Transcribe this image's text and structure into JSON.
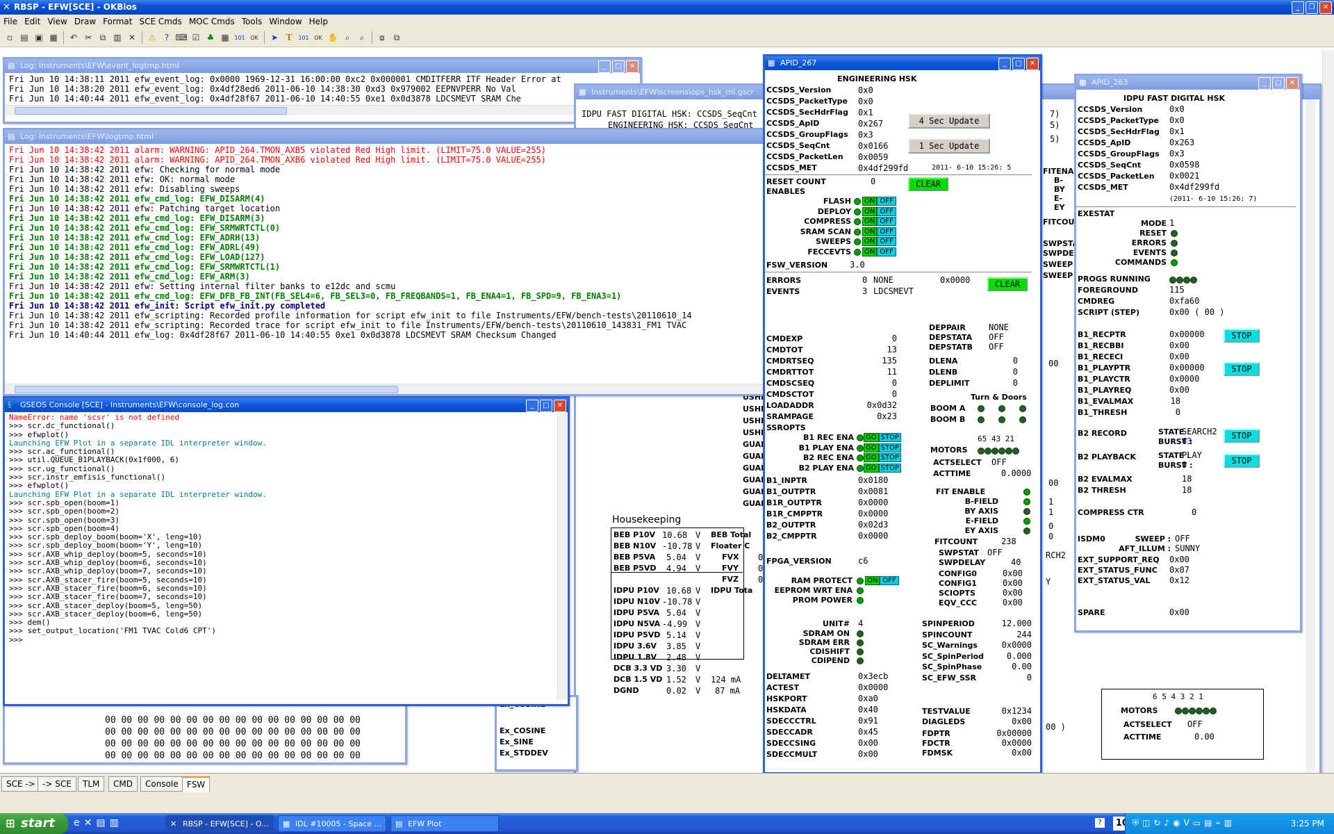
{
  "app": {
    "title": "RBSP - EFW[SCE] - OKBios"
  },
  "menu": [
    "File",
    "Edit",
    "View",
    "Draw",
    "Format",
    "SCE Cmds",
    "MOC Cmds",
    "Tools",
    "Window",
    "Help"
  ],
  "event_log": {
    "title": "Log: Instruments\\EFW\\event_logtmp.html",
    "lines": [
      "Fri Jun 10 14:38:11 2011 efw_event_log: 0x0000 1969-12-31 16:00:00 0xc2 0x000001 CMDITFERR ITF Header Error at",
      "Fri Jun 10 14:38:20 2011 efw_event_log: 0x4df28ed6 2011-06-10 14:38:30 0xd3 0x979002 EEPNVPERR No Val",
      "Fri Jun 10 14:40:44 2011 efw_event_log: 0x4df28f67 2011-06-10 14:40:55 0xe1 0x0d3878 LDCSMEVT SRAM Che"
    ]
  },
  "log": {
    "title": "Log: Instruments\\EFW\\logtmp.html",
    "lines": [
      {
        "t": "Fri Jun 10 14:38:42 2011 alarm: WARNING: APID_264.TMON_AXB5 violated Red High limit. (LIMIT=75.0 VALUE=255)",
        "c": "red"
      },
      {
        "t": "Fri Jun 10 14:38:42 2011 alarm: WARNING: APID_264.TMON_AXB6 violated Red High limit. (LIMIT=75.0 VALUE=255)",
        "c": "red"
      },
      {
        "t": "Fri Jun 10 14:38:42 2011 efw: Checking for normal mode",
        "c": ""
      },
      {
        "t": "Fri Jun 10 14:38:42 2011 efw: OK: normal mode",
        "c": ""
      },
      {
        "t": "Fri Jun 10 14:38:42 2011 efw: Disabling sweeps",
        "c": ""
      },
      {
        "t": "Fri Jun 10 14:38:42 2011 efw_cmd_log: EFW_DISARM(4)",
        "c": "grn"
      },
      {
        "t": "Fri Jun 10 14:38:42 2011 efw: Patching target location",
        "c": ""
      },
      {
        "t": "Fri Jun 10 14:38:42 2011 efw_cmd_log: EFW_DISARM(3)",
        "c": "grn"
      },
      {
        "t": "Fri Jun 10 14:38:42 2011 efw_cmd_log: EFW_SRMWRTCTL(0)",
        "c": "grn"
      },
      {
        "t": "Fri Jun 10 14:38:42 2011 efw_cmd_log: EFW_ADRH(13)",
        "c": "grn"
      },
      {
        "t": "Fri Jun 10 14:38:42 2011 efw_cmd_log: EFW_ADRL(49)",
        "c": "grn"
      },
      {
        "t": "Fri Jun 10 14:38:42 2011 efw_cmd_log: EFW_LOAD(127)",
        "c": "grn"
      },
      {
        "t": "Fri Jun 10 14:38:42 2011 efw_cmd_log: EFW_SRMWRTCTL(1)",
        "c": "grn"
      },
      {
        "t": "Fri Jun 10 14:38:42 2011 efw_cmd_log: EFW_ARM(3)",
        "c": "grn"
      },
      {
        "t": "Fri Jun 10 14:38:42 2011 efw: Setting internal filter banks to e12dc and scmu",
        "c": ""
      },
      {
        "t": "Fri Jun 10 14:38:42 2011 efw_cmd_log: EFW_DFB_FB_INT(FB_SEL4=6, FB_SEL3=0, FB_FREQBANDS=1, FB_ENA4=1, FB_SPD=9, FB_ENA3=1)",
        "c": "grn"
      },
      {
        "t": "Fri Jun 10 14:38:42 2011 efw_init: Script efw_init.py completed",
        "c": "blu"
      },
      {
        "t": "Fri Jun 10 14:38:42 2011 efw_scripting: Recorded profile information for script efw_init to file Instruments/EFW/bench-tests\\20110610_14",
        "c": ""
      },
      {
        "t": "Fri Jun 10 14:38:42 2011 efw_scripting: Recorded trace for script efw_init to file Instruments/EFW/bench-tests\\20110610_143831_FM1 TVAC",
        "c": ""
      },
      {
        "t": "Fri Jun 10 14:40:44 2011 efw_log: 0x4df28f67 2011-06-10 14:40:55 0xe1 0x0d3878 LDCSMEVT SRAM Checksum Changed",
        "c": ""
      }
    ]
  },
  "console": {
    "title": "GSEOS Console  [SCE] - Instruments\\EFW\\console_log.con",
    "lines": [
      {
        "t": "NameError: name 'scsr' is not defined",
        "c": "red"
      },
      {
        "t": ">>> scr.dc_functional()",
        "c": ""
      },
      {
        "t": ">>> efwplot()",
        "c": ""
      },
      {
        "t": "Launching EFW Plot in a separate IDL interpreter window.",
        "c": "cyn"
      },
      {
        "t": ">>> scr.ac_functional()",
        "c": ""
      },
      {
        "t": ">>> util.QUEUE_B1PLAYBACK(0x1f000, 6)",
        "c": ""
      },
      {
        "t": ">>> scr.ug_functional()",
        "c": ""
      },
      {
        "t": ">>> scr.instr_emfisis_functional()",
        "c": ""
      },
      {
        "t": ">>> efwplot()",
        "c": ""
      },
      {
        "t": "Launching EFW Plot in a separate IDL interpreter window.",
        "c": "cyn"
      },
      {
        "t": ">>> scr.spb_open(boom=1)",
        "c": ""
      },
      {
        "t": ">>> scr.spb_open(boom=2)",
        "c": ""
      },
      {
        "t": ">>> scr.spb_open(boom=3)",
        "c": ""
      },
      {
        "t": ">>> scr.spb_open(boom=4)",
        "c": ""
      },
      {
        "t": ">>> scr.spb_deploy_boom(boom='X', leng=10)",
        "c": ""
      },
      {
        "t": ">>> scr.spb_deploy_boom(boom='Y', leng=10)",
        "c": ""
      },
      {
        "t": ">>> scr.AXB_whip_deploy(boom=5, seconds=10)",
        "c": ""
      },
      {
        "t": ">>> scr.AXB_whip_deploy(boom=6, seconds=10)",
        "c": ""
      },
      {
        "t": ">>> scr.AXB_whip_deploy(boom=7, seconds=10)",
        "c": ""
      },
      {
        "t": ">>> scr.AXB_stacer_fire(boom=5, seconds=10)",
        "c": ""
      },
      {
        "t": ">>> scr.AXB_stacer_fire(boom=6, seconds=10)",
        "c": ""
      },
      {
        "t": ">>> scr.AXB_stacer_fire(boom=7, seconds=10)",
        "c": ""
      },
      {
        "t": ">>> scr.AXB_stacer_deploy(boom=5, leng=50)",
        "c": ""
      },
      {
        "t": ">>> scr.AXB_stacer_deploy(boom=6, leng=50)",
        "c": ""
      },
      {
        "t": ">>> dem()",
        "c": ""
      },
      {
        "t": ">>> set_output_location('FM1 TVAC Cold6 CPT')",
        "c": ""
      },
      {
        "t": ">>>",
        "c": ""
      }
    ]
  },
  "hex_dump": {
    "lines": [
      "00 00 00 00 00 00 00 00 00 00 00 00 00 00 00 00",
      "00 00 00 00 00 00 00 00 00 00 00 00 00 00 00 00",
      "00 00 00 00 00 00 00 00 00 00 00 00 00 00 00 00",
      "00 00 00 00 00 00 00 00 00 00 00 00 00 00 00 00"
    ]
  },
  "ex_labels": [
    "Ex_COSINE",
    "Ex_SINE",
    "Ex_STDDEV"
  ],
  "ops_hsk": {
    "title": "Instruments\\EFW\\screens\\ops_hsk_ml.gscr",
    "header": "IDPU FAST DIGITAL HSK: CCSDS_SeqCnt",
    "header2": "ENGINEERING HSK: CCSDS_SeqCnt",
    "right_frag": [
      "7)",
      "5)",
      "5)"
    ],
    "right_labels": [
      "FITENA",
      "B-",
      "BY",
      "E-",
      "EY",
      "FITCOU",
      "SWPSTA",
      "SWPDEL",
      "SWEEP",
      "SWEEP"
    ],
    "ushe": [
      "USHE",
      "USHE",
      "USHE",
      "USHE",
      "GUAR",
      "GUAR",
      "GUAR",
      "GUAR",
      "GUAR",
      "GUAR"
    ],
    "housekeeping_label": "Housekeeping",
    "beb": [
      {
        "l": "BEB P10V",
        "v": "10.68",
        "u": "V"
      },
      {
        "l": "BEB N10V",
        "v": "-10.78",
        "u": "V"
      },
      {
        "l": "BEB P5VA",
        "v": "5.04",
        "u": "V"
      },
      {
        "l": "BEB P5VD",
        "v": "4.94",
        "u": "V"
      }
    ],
    "beb_right": {
      "total": "BEB Total",
      "floater": "Floater C",
      "fvx": "FVX",
      "fvy": "FVY",
      "fvz": "FVZ",
      "zero": "0"
    },
    "idpu": [
      {
        "l": "IDPU P10V",
        "v": "10.68",
        "u": "V"
      },
      {
        "l": "IDPU N10V",
        "v": "-10.78",
        "u": "V"
      },
      {
        "l": "IDPU P5VA",
        "v": "5.04",
        "u": "V"
      },
      {
        "l": "IDPU N5VA",
        "v": "-4.99",
        "u": "V"
      },
      {
        "l": "IDPU P5VD",
        "v": "5.14",
        "u": "V"
      },
      {
        "l": "IDPU 3.6V",
        "v": "3.85",
        "u": "V"
      },
      {
        "l": "IDPU 1.8V",
        "v": "2.48",
        "u": "V"
      },
      {
        "l": "DCB 3.3 VD",
        "v": "3.30",
        "u": "V"
      },
      {
        "l": "DCB 1.5 VD",
        "v": "1.52",
        "u": "V"
      },
      {
        "l": "DGND",
        "v": "0.02",
        "u": "V"
      }
    ],
    "idpu_total": "IDPU Tota",
    "ma1": "124 mA",
    "ma2": "87 mA",
    "zeros": [
      "00",
      "00",
      "1",
      "1",
      "0",
      "0"
    ],
    "srch": "RCH2",
    "y": "Y",
    "paren": "00 )"
  },
  "apid267": {
    "title": "APID_267",
    "heading": "ENGINEERING HSK",
    "ccsds": [
      {
        "l": "CCSDS_Version",
        "v": "0x0"
      },
      {
        "l": "CCSDS_PacketType",
        "v": "0x0"
      },
      {
        "l": "CCSDS_SecHdrFlag",
        "v": "0x1"
      },
      {
        "l": "CCSDS_ApID",
        "v": "0x267"
      },
      {
        "l": "CCSDS_GroupFlags",
        "v": "0x3"
      },
      {
        "l": "CCSDS_SeqCnt",
        "v": "0x0166"
      },
      {
        "l": "CCSDS_PacketLen",
        "v": "0x0059"
      },
      {
        "l": "CCSDS_MET",
        "v": "0x4df299fd"
      }
    ],
    "met_time": "2011- 6-10  15:26: 5",
    "btn4": "4 Sec Update",
    "btn1": "1 Sec Update",
    "reset_count_l": "RESET COUNT",
    "reset_count_v": "0",
    "clear": "CLEAR",
    "enables_l": "ENABLES",
    "enables": [
      "FLASH",
      "DEPLOY",
      "COMPRESS",
      "SRAM SCAN",
      "SWEEPS",
      "FECCEVTS"
    ],
    "on": "ON",
    "off": "OFF",
    "go": "GO",
    "stop": "STOP",
    "fsw_l": "FSW_VERSION",
    "fsw_v": "3.0",
    "errors_l": "ERRORS",
    "errors_v": "0",
    "errors_n": "NONE",
    "errors_h": "0x0000",
    "events_l": "EVENTS",
    "events_v": "3",
    "events_n": "LDCSMEVT",
    "left": [
      {
        "l": "CMDEXP",
        "v": "0"
      },
      {
        "l": "CMDTOT",
        "v": "13"
      },
      {
        "l": "CMDRTSEQ",
        "v": "135"
      },
      {
        "l": "CMDRTTOT",
        "v": "11"
      },
      {
        "l": "CMDSCSEQ",
        "v": "0"
      },
      {
        "l": "CMDSCTOT",
        "v": "0"
      },
      {
        "l": "LOADADDR",
        "v": "0x0d32"
      },
      {
        "l": "SRAMPAGE",
        "v": "0x23"
      }
    ],
    "ssropts": "SSROPTS",
    "ssr": [
      "B1 REC ENA",
      "B1 PLAY ENA",
      "B2 REC ENA",
      "B2 PLAY ENA"
    ],
    "ptrs": [
      {
        "l": "B1_INPTR",
        "v": "0x0180"
      },
      {
        "l": "B1_OUTPTR",
        "v": "0x0081"
      },
      {
        "l": "B1R_OUTPTR",
        "v": "0x0000"
      },
      {
        "l": "B1R_CMPPTR",
        "v": "0x0000"
      },
      {
        "l": "B2_OUTPTR",
        "v": "0x02d3"
      },
      {
        "l": "B2_CMPPTR",
        "v": "0x0000"
      }
    ],
    "fpga_l": "FPGA_VERSION",
    "fpga_v": "c6",
    "ram": [
      "RAM PROTECT",
      "EEPROM WRT ENA",
      "PROM POWER"
    ],
    "unit_l": "UNIT#",
    "unit_v": "4",
    "sdram": [
      "SDRAM ON",
      "SDRAM ERR",
      "CDISHIFT",
      "CDIPEND"
    ],
    "bottom": [
      {
        "l": "DELTAMET",
        "v": "0x3ecb"
      },
      {
        "l": "ACTEST",
        "v": "0x0000"
      },
      {
        "l": "HSKPORT",
        "v": "0xa0"
      },
      {
        "l": "HSKDATA",
        "v": "0x40"
      },
      {
        "l": "SDECCCTRL",
        "v": "0x91"
      },
      {
        "l": "SDECCADR",
        "v": "0x45"
      },
      {
        "l": "SDECCSING",
        "v": "0x00"
      },
      {
        "l": "SDECCMULT",
        "v": "0x00"
      }
    ],
    "dep": [
      {
        "l": "DEPPAIR",
        "v": "NONE"
      },
      {
        "l": "DEPSTATA",
        "v": "OFF"
      },
      {
        "l": "DEPSTATB",
        "v": "OFF"
      },
      {
        "l": "DLENA",
        "v": "0"
      },
      {
        "l": "DLENB",
        "v": "0"
      },
      {
        "l": "DEPLIMIT",
        "v": "0"
      }
    ],
    "turn": "Turn & Doors",
    "boom_a": "BOOM A",
    "boom_b": "BOOM B",
    "motors_nums": "65 43 21",
    "motors_l": "MOTORS",
    "actselect_l": "ACTSELECT",
    "actselect_v": "OFF",
    "acttime_l": "ACTTIME",
    "acttime_v": "0.0000",
    "fit_l": "FIT ENABLE",
    "fit": [
      "B-FIELD",
      "BY AXIS",
      "E-FIELD",
      "EY AXIS"
    ],
    "fitcount_l": "FITCOUNT",
    "fitcount_v": "238",
    "swpstat_l": "SWPSTAT",
    "swpstat_v": "OFF",
    "swpdelay_l": "SWPDELAY",
    "swpdelay_v": "40",
    "cfg": [
      {
        "l": "CONFIG0",
        "v": "0x00"
      },
      {
        "l": "CONFIG1",
        "v": "0x00"
      },
      {
        "l": "SCIOPTS",
        "v": "0x00"
      },
      {
        "l": "EQV_CCC",
        "v": "0x00"
      }
    ],
    "spin": [
      {
        "l": "SPINPERIOD",
        "v": "12.000"
      },
      {
        "l": "SPINCOUNT",
        "v": "244"
      },
      {
        "l": "SC_Warnings",
        "v": "0x0000"
      },
      {
        "l": "SC_SpinPeriod",
        "v": "0.000"
      },
      {
        "l": "SC_SpinPhase",
        "v": "0.00"
      },
      {
        "l": "SC_EFW_SSR",
        "v": "0"
      }
    ],
    "test": [
      {
        "l": "TESTVALUE",
        "v": "0x1234"
      },
      {
        "l": "DIAGLEDS",
        "v": "0x00"
      }
    ],
    "fd": [
      {
        "l": "FDPTR",
        "v": "0x00000"
      },
      {
        "l": "FDCTR",
        "v": "0x0000"
      },
      {
        "l": "FDMSK",
        "v": "0x00"
      }
    ]
  },
  "apid263": {
    "title": "APID_263",
    "heading": "IDPU FAST DIGITAL HSK",
    "ccsds": [
      {
        "l": "CCSDS_Version",
        "v": "0x0"
      },
      {
        "l": "CCSDS_PacketType",
        "v": "0x0"
      },
      {
        "l": "CCSDS_SecHdrFlag",
        "v": "0x1"
      },
      {
        "l": "CCSDS_ApID",
        "v": "0x263"
      },
      {
        "l": "CCSDS_GroupFlags",
        "v": "0x3"
      },
      {
        "l": "CCSDS_SeqCnt",
        "v": "0x0598"
      },
      {
        "l": "CCSDS_PacketLen",
        "v": "0x0021"
      },
      {
        "l": "CCSDS_MET",
        "v": "0x4df299fd"
      }
    ],
    "met_time": "(2011- 6-10  15:26: 7)",
    "exestat": "EXESTAT",
    "mode_l": "MODE",
    "mode_v": "1",
    "flags": [
      "RESET",
      "ERRORS",
      "EVENTS",
      "COMMANDS"
    ],
    "progs_l": "PROGS RUNNING",
    "rows1": [
      {
        "l": "FOREGROUND",
        "v": "115"
      },
      {
        "l": "CMDREG",
        "v": "0xfa60"
      },
      {
        "l": "SCRIPT (STEP)",
        "v": "0x00 ( 00 )"
      }
    ],
    "b1": [
      {
        "l": "B1_RECPTR",
        "v": "0x00000"
      },
      {
        "l": "B1_RECBBI",
        "v": "0x00"
      },
      {
        "l": "B1_RECECI",
        "v": "0x00"
      },
      {
        "l": "B1_PLAYPTR",
        "v": "0x00000"
      },
      {
        "l": "B1_PLAYCTR",
        "v": "0x0000"
      },
      {
        "l": "B1_PLAYREQ",
        "v": "0x00"
      },
      {
        "l": "B1_EVALMAX",
        "v": "18"
      },
      {
        "l": "B1_THRESH",
        "v": "0"
      }
    ],
    "stop": "STOP",
    "b2rec_l": "B2 RECORD",
    "state_l": "STATE :",
    "burst_l": "BURST :",
    "b2rec_state": "SEARCH2",
    "b2rec_burst": "63",
    "b2play_l": "B2 PLAYBACK",
    "b2play_state": "PLAY",
    "b2play_burst": "0",
    "b2eval_l": "B2 EVALMAX",
    "b2eval_v": "18",
    "b2thr_l": "B2 THRESH",
    "b2thr_v": "18",
    "compress_l": "COMPRESS CTR",
    "compress_v": "0",
    "isdm_l": "ISDM0",
    "sweep_l": "SWEEP :",
    "sweep_v": "OFF",
    "aft_l": "AFT_ILLUM :",
    "aft_v": "SUNNY",
    "ext": [
      {
        "l": "EXT_SUPPORT_REQ",
        "v": "0x00"
      },
      {
        "l": "EXT_STATUS_FUNC",
        "v": "0x07"
      },
      {
        "l": "EXT_STATUS_VAL",
        "v": "0x12"
      }
    ],
    "spare_l": "SPARE",
    "spare_v": "0x00"
  },
  "lower_box": {
    "nums": "6 5 4 3 2 1",
    "motors_l": "MOTORS",
    "actselect_l": "ACTSELECT",
    "actselect_v": "OFF",
    "acttime_l": "ACTTIME",
    "acttime_v": "0.00"
  },
  "tabs": [
    "SCE ->",
    "-> SCE",
    "TLM",
    "CMD",
    "Console",
    "FSW"
  ],
  "taskbar": {
    "start": "start",
    "tasks": [
      "RBSP - EFW[SCE] - O...",
      "IDL #10005 - Space ...",
      "EFW Plot"
    ],
    "zoom": "100%",
    "clock": "3:25 PM"
  }
}
